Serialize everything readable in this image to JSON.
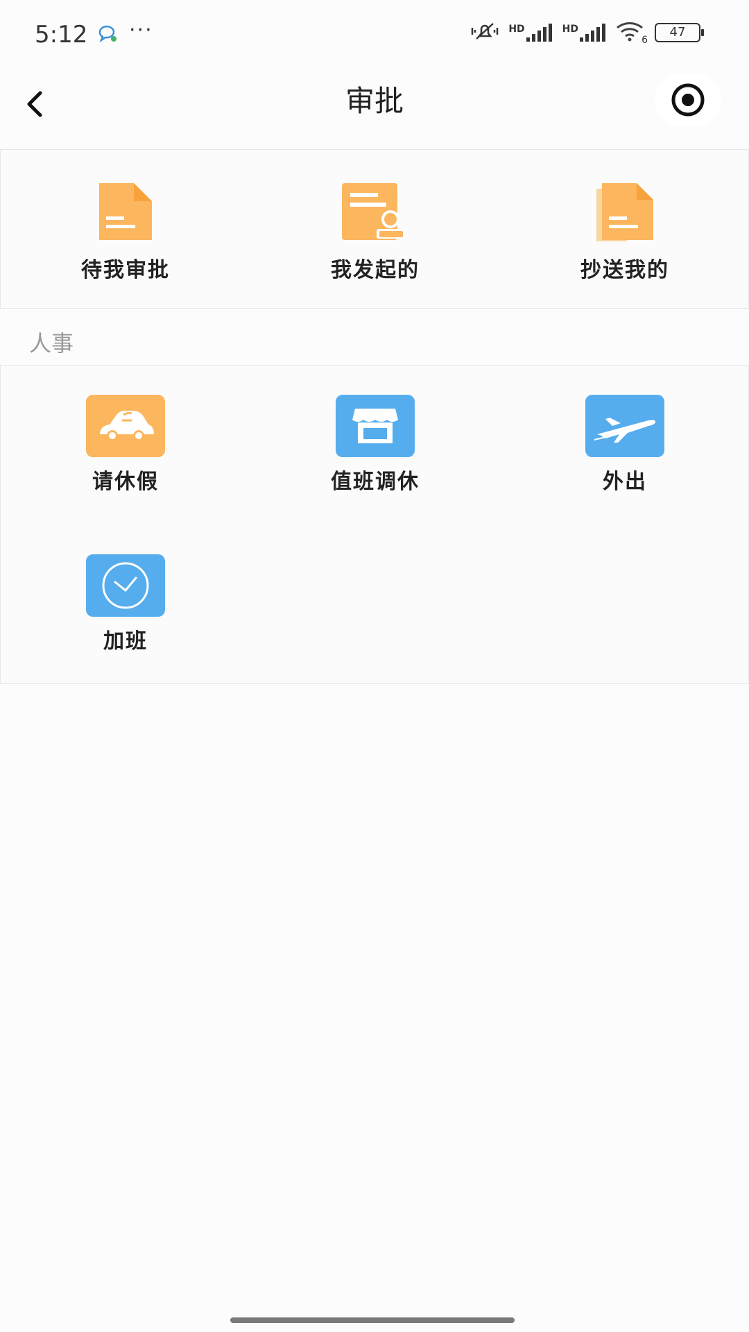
{
  "status_bar": {
    "time": "5:12",
    "dots": "···",
    "hd1": "HD",
    "hd2": "HD",
    "wifi_badge": "6",
    "battery": "47"
  },
  "header": {
    "title": "审批"
  },
  "approvals": {
    "items": [
      {
        "label": "待我审批",
        "icon": "document-icon"
      },
      {
        "label": "我发起的",
        "icon": "document-stamp-icon"
      },
      {
        "label": "抄送我的",
        "icon": "copy-document-icon"
      }
    ]
  },
  "hr_section": {
    "label": "人事",
    "items": [
      {
        "label": "请休假",
        "icon": "car-icon",
        "color": "#fbb65e"
      },
      {
        "label": "值班调休",
        "icon": "shop-icon",
        "color": "#55adee"
      },
      {
        "label": "外出",
        "icon": "airplane-icon",
        "color": "#55adee"
      },
      {
        "label": "加班",
        "icon": "clock-icon",
        "color": "#55adee"
      }
    ]
  },
  "colors": {
    "orange": "#fbb65e",
    "blue": "#55adee"
  }
}
